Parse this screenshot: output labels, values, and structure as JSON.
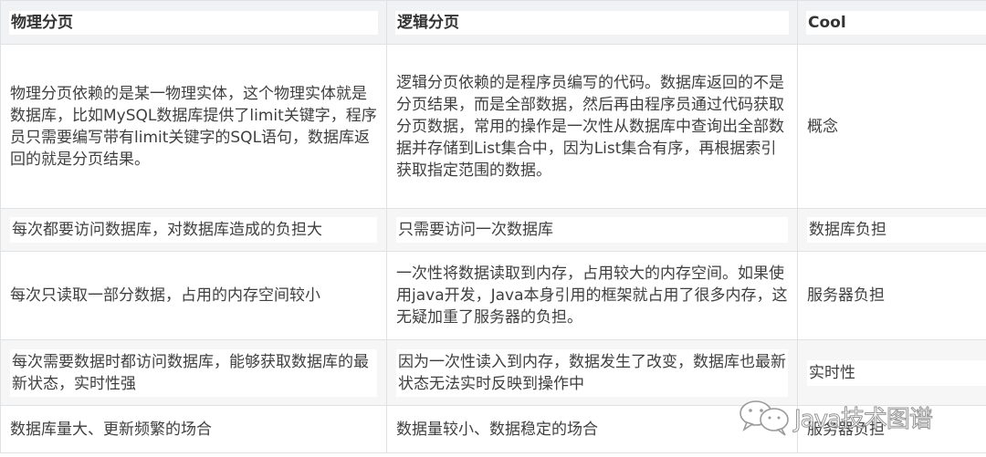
{
  "table": {
    "headers": [
      "物理分页",
      "逻辑分页",
      "Cool"
    ],
    "rows": [
      {
        "physical": "物理分页依赖的是某一物理实体，这个物理实体就是数据库，比如MySQL数据库提供了limit关键字，程序员只需要编写带有limit关键字的SQL语句，数据库返回的就是分页结果。",
        "logical": "逻辑分页依赖的是程序员编写的代码。数据库返回的不是分页结果，而是全部数据，然后再由程序员通过代码获取分页数据，常用的操作是一次性从数据库中查询出全部数据并存储到List集合中，因为List集合有序，再根据索引获取指定范围的数据。",
        "aspect": "概念"
      },
      {
        "physical": "每次都要访问数据库，对数据库造成的负担大",
        "logical": "只需要访问一次数据库",
        "aspect": "数据库负担"
      },
      {
        "physical": "每次只读取一部分数据，占用的内存空间较小",
        "logical": "一次性将数据读取到内存，占用较大的内存空间。如果使用java开发，Java本身引用的框架就占用了很多内存，这无疑加重了服务器的负担。",
        "aspect": "服务器负担"
      },
      {
        "physical": "每次需要数据时都访问数据库，能够获取数据库的最新状态，实时性强",
        "logical": "因为一次性读入到内存，数据发生了改变，数据库也最新状态无法实时反映到操作中",
        "aspect": "实时性"
      },
      {
        "physical": "数据库量大、更新频繁的场合",
        "logical": "数据量较小、数据稳定的场合",
        "aspect": "服务器负担"
      }
    ]
  },
  "watermark": {
    "icon": "wechat-icon",
    "text": "Java技术图谱"
  }
}
